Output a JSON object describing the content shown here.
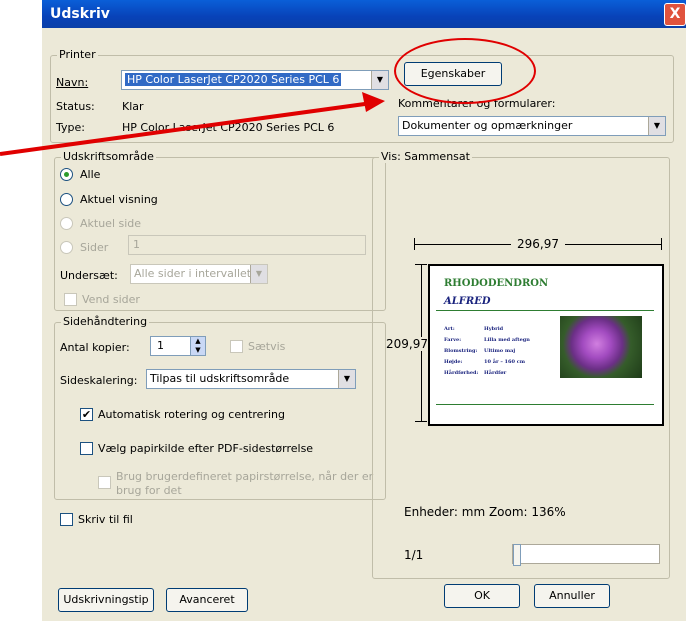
{
  "window": {
    "title": "Udskriv",
    "close_label": "X"
  },
  "printer": {
    "group_title": "Printer",
    "name_label": "Navn:",
    "name_value": "HP Color LaserJet CP2020 Series PCL 6",
    "status_label": "Status:",
    "status_value": "Klar",
    "type_label": "Type:",
    "type_value": "HP Color LaserJet CP2020 Series PCL 6",
    "properties_button": "Egenskaber",
    "comments_label": "Kommentarer og formularer:",
    "comments_value": "Dokumenter og opmærkninger"
  },
  "print_range": {
    "group_title": "Udskriftsområde",
    "all": "Alle",
    "current_view": "Aktuel visning",
    "current_page": "Aktuel side",
    "pages": "Sider",
    "pages_value": "1",
    "subset_label": "Undersæt:",
    "subset_value": "Alle sider i intervallet",
    "reverse_pages": "Vend sider"
  },
  "page_handling": {
    "group_title": "Sidehåndtering",
    "copies_label": "Antal kopier:",
    "copies_value": "1",
    "collate": "Sætvis",
    "scaling_label": "Sideskalering:",
    "scaling_value": "Tilpas til udskriftsområde",
    "auto_rotate": "Automatisk rotering og centrering",
    "paper_source": "Vælg papirkilde efter PDF-sidestørrelse",
    "custom_paper_line1": "Brug brugerdefineret papirstørrelse, når der er",
    "custom_paper_line2": "brug for det"
  },
  "print_to_file": "Skriv til fil",
  "preview": {
    "group_title": "Vis: Sammensat",
    "width_dim": "296,97",
    "height_dim": "209,97",
    "units_zoom": "Enheder: mm Zoom: 136%",
    "page_counter": "1/1",
    "doc": {
      "title": "RHODODENDRON",
      "subtitle": "ALFRED",
      "rows": [
        {
          "k": "Art:",
          "v": "Hybrid"
        },
        {
          "k": "Farve:",
          "v": "Lilla med aftegn"
        },
        {
          "k": "Blomstring:",
          "v": "Ultimo maj"
        },
        {
          "k": "Højde:",
          "v": "10 år – 160 cm"
        },
        {
          "k": "Hårdførhed:",
          "v": "Hårdfør"
        }
      ]
    }
  },
  "buttons": {
    "print_tips": "Udskrivningstip",
    "advanced": "Avanceret",
    "ok": "OK",
    "cancel": "Annuller"
  },
  "colors": {
    "title_bar": "#0842b8",
    "annotation": "#e00000",
    "doc_title": "#2e7d32",
    "doc_subtitle": "#1a237e"
  }
}
